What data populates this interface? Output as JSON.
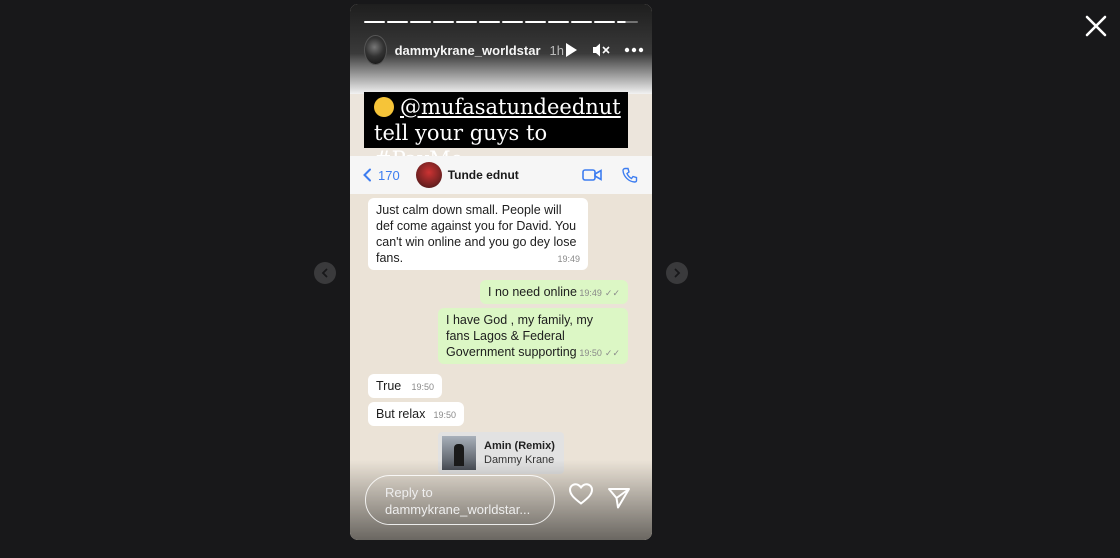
{
  "story": {
    "username": "dammykrane_worldstar",
    "time": "1h",
    "progress_segments": 12,
    "caption": {
      "line1_mention": "@mufasatundeednut",
      "line2_prefix": "tell your guys to ",
      "hashtag": "#PayMe"
    },
    "whatsapp": {
      "back_count": "170",
      "contact_name": "Tunde ednut"
    },
    "messages": [
      {
        "dir": "in",
        "text": "Just calm down small. People will def come against you for David. You can't win online and you go dey lose fans.",
        "time": "19:49"
      },
      {
        "dir": "out",
        "text": "I no need online",
        "time": "19:49"
      },
      {
        "dir": "out",
        "text": "I have God , my family, my fans Lagos & Federal Government supporting",
        "time": "19:50"
      },
      {
        "dir": "in",
        "text": "True",
        "time": "19:50"
      },
      {
        "dir": "in",
        "text": "But relax",
        "time": "19:50"
      }
    ],
    "music": {
      "title": "Amin (Remix)",
      "artist": "Dammy Krane"
    },
    "reply_placeholder": "Reply to dammykrane_worldstar..."
  },
  "icons": {
    "close": "close-icon",
    "prev": "chevron-left-icon",
    "next": "chevron-right-icon",
    "play": "play-icon",
    "mute": "muted-speaker-icon",
    "more": "more-horizontal-icon",
    "like": "heart-icon",
    "share": "send-icon"
  }
}
